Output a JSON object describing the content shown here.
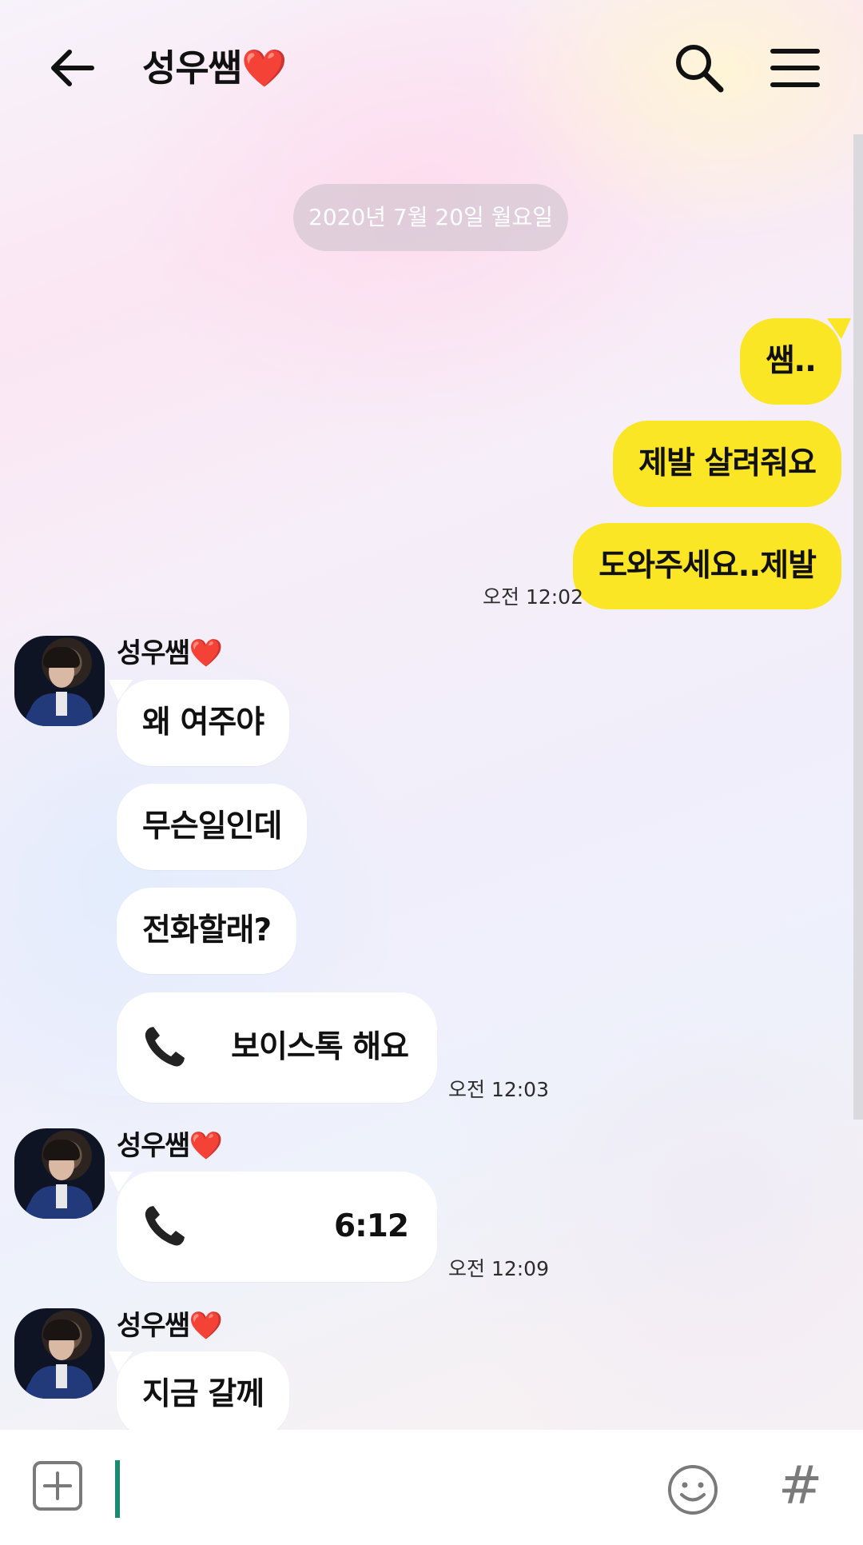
{
  "header": {
    "title": "성우쌤",
    "heart": "❤️"
  },
  "date_divider": "2020년 7월 20일 월요일",
  "messages_me": [
    {
      "text": "쌤.."
    },
    {
      "text": "제발 살려줘요"
    },
    {
      "text": "도와주세요..제발"
    }
  ],
  "time_me": "오전 12:02",
  "sender_name": "성우쌤",
  "group1": [
    {
      "text": "왜 여주야"
    },
    {
      "text": "무슨일인데"
    },
    {
      "text": "전화할래?"
    }
  ],
  "call1": {
    "text": "보이스톡 해요",
    "icon": "phone-icon"
  },
  "time1": "오전 12:03",
  "call2": {
    "text": "6:12",
    "icon": "phone-icon"
  },
  "time2": "오전 12:09",
  "group3": [
    {
      "text": "지금 갈께"
    }
  ],
  "input": {
    "placeholder": ""
  },
  "icons": {
    "back": "arrow-left-icon",
    "search": "search-icon",
    "menu": "menu-icon",
    "add": "plus-icon",
    "emoji": "smiley-icon",
    "hash": "#"
  },
  "colors": {
    "my_bubble": "#fbe625",
    "other_bubble": "#ffffff",
    "cursor": "#1a8a73",
    "heart": "#e01b24"
  }
}
